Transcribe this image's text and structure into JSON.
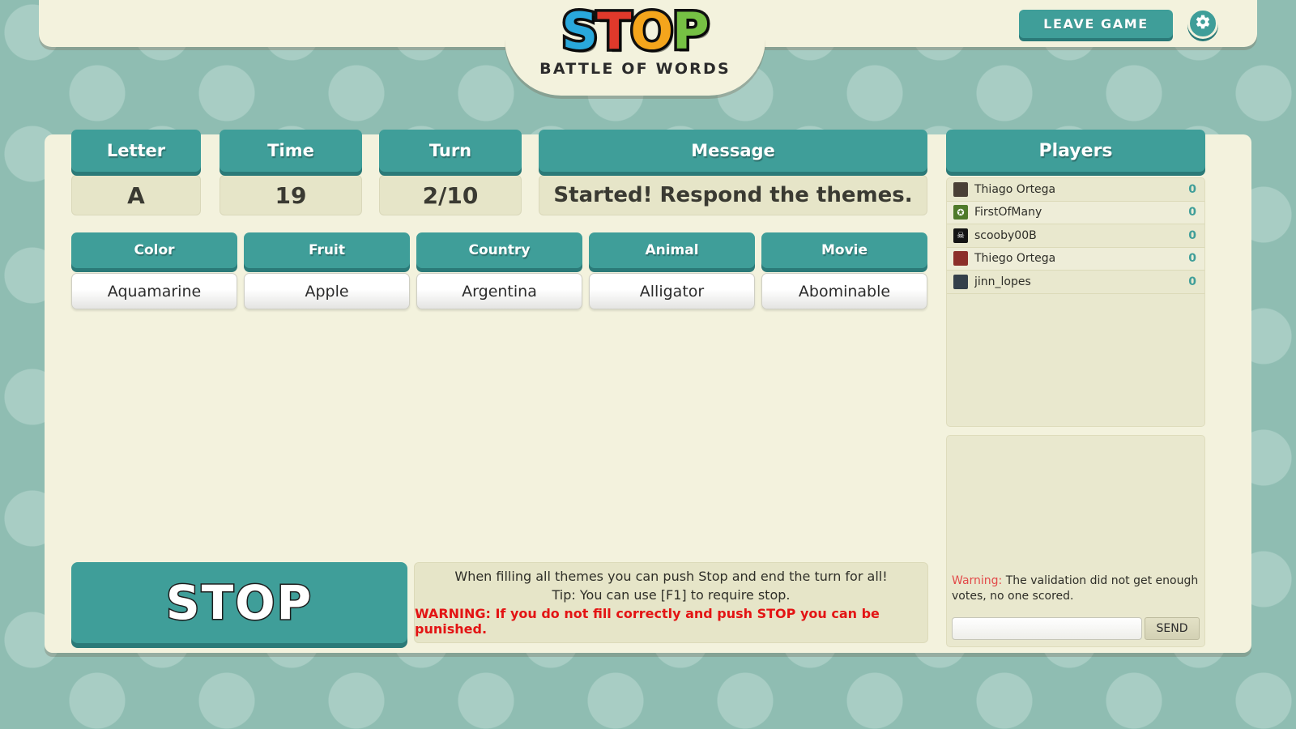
{
  "header": {
    "logo": {
      "letters": [
        {
          "char": "S",
          "color": "#29a8dc"
        },
        {
          "char": "T",
          "color": "#e0392b"
        },
        {
          "char": "O",
          "color": "#f4a51c"
        },
        {
          "char": "P",
          "color": "#76c044"
        }
      ],
      "subtitle": "BATTLE OF WORDS"
    },
    "leave_game_label": "LEAVE GAME",
    "settings_icon": "gear-icon"
  },
  "status": {
    "letter": {
      "label": "Letter",
      "value": "A"
    },
    "time": {
      "label": "Time",
      "value": "19"
    },
    "turn": {
      "label": "Turn",
      "value": "2/10"
    },
    "message": {
      "label": "Message",
      "value": "Started! Respond the themes."
    }
  },
  "themes": [
    {
      "label": "Color",
      "value": "Aquamarine"
    },
    {
      "label": "Fruit",
      "value": "Apple"
    },
    {
      "label": "Country",
      "value": "Argentina"
    },
    {
      "label": "Animal",
      "value": "Alligator"
    },
    {
      "label": "Movie",
      "value": "Abominable"
    }
  ],
  "stop_button_label": "STOP",
  "tip": {
    "line1": "When filling all themes you can push Stop and end the turn for all!",
    "line2": "Tip: You can use [F1] to require stop.",
    "warning": "WARNING: If you do not fill correctly and push STOP you can be punished."
  },
  "players": {
    "header": "Players",
    "rows": [
      {
        "name": "Thiago Ortega",
        "score": "0",
        "avatar": "photo-avatar",
        "avatar_bg": "#4a4036",
        "glyph": ""
      },
      {
        "name": "FirstOfMany",
        "score": "0",
        "avatar": "star-badge-avatar",
        "avatar_bg": "#4f7a2a",
        "glyph": "✪"
      },
      {
        "name": "scooby00B",
        "score": "0",
        "avatar": "skull-avatar",
        "avatar_bg": "#141414",
        "glyph": "☠"
      },
      {
        "name": "Thiego Ortega",
        "score": "0",
        "avatar": "photo-avatar",
        "avatar_bg": "#8c2f2a",
        "glyph": ""
      },
      {
        "name": "jinn_lopes",
        "score": "0",
        "avatar": "photo-avatar",
        "avatar_bg": "#34404a",
        "glyph": ""
      }
    ]
  },
  "chat": {
    "warning_label": "Warning:",
    "warning_text": " The validation did not get enough votes, no one scored.",
    "input_value": "",
    "input_placeholder": "",
    "send_label": "SEND"
  },
  "colors": {
    "teal": "#3f9e99",
    "teal_shadow": "#2b7a78",
    "cream": "#f3f2dd",
    "panel": "#e6e5c8",
    "background": "#8fbdb2",
    "warning_red": "#e31414"
  }
}
